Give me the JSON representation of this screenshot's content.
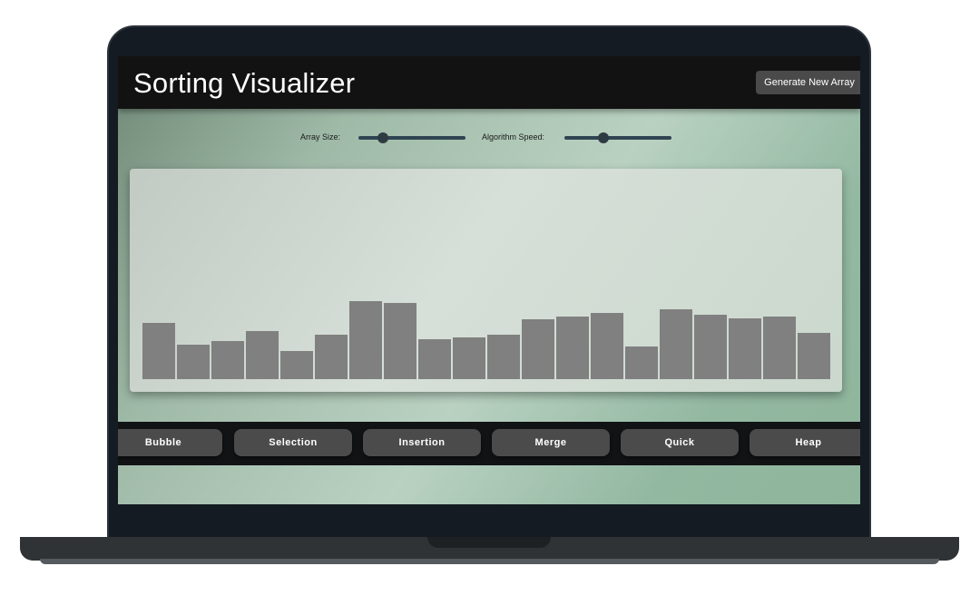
{
  "app": {
    "title": "Sorting Visualizer",
    "generate_button": "Generate New Array"
  },
  "controls": {
    "array_size_label": "Array Size:",
    "array_size_value": 0.2,
    "speed_label": "Algorithm Speed:",
    "speed_value": 0.35
  },
  "bars": [
    62,
    38,
    42,
    53,
    31,
    49,
    86,
    84,
    44,
    46,
    49,
    66,
    69,
    73,
    36,
    77,
    71,
    67,
    69,
    51
  ],
  "algorithms": [
    "Bubble",
    "Selection",
    "Insertion",
    "Merge",
    "Quick",
    "Heap"
  ],
  "colors": {
    "bar": "#808080",
    "header_bg": "#121212",
    "button_bg": "#4b4b4b"
  }
}
